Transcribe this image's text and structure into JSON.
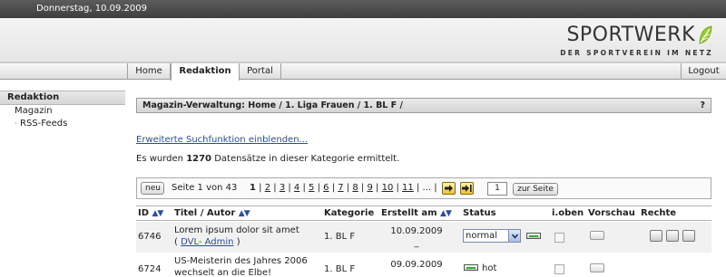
{
  "topbar": {
    "date": "Donnerstag, 10.09.2009"
  },
  "logo": {
    "word": "SPORTWERK",
    "sub": "DER SPORTVEREIN IM NETZ"
  },
  "nav": {
    "tabs": [
      "Home",
      "Redaktion",
      "Portal"
    ],
    "active": "Redaktion",
    "logout": "Logout"
  },
  "sidebar": {
    "header": "Redaktion",
    "items": [
      "Magazin"
    ],
    "subitems": [
      "RSS-Feeds"
    ]
  },
  "main": {
    "breadcrumb": "Magazin-Verwaltung: Home / 1. Liga Frauen / 1. BL F /",
    "help": "?",
    "advanced_link": "Erweiterte Suchfunktion einblenden...",
    "count_pre": "Es wurden",
    "count": "1270",
    "count_post": "Datensätze in dieser Kategorie ermittelt.",
    "pager": {
      "new_label": "neu",
      "page_info": "Seite 1 von 43",
      "current": "1",
      "pages": [
        "2",
        "3",
        "4",
        "5",
        "6",
        "7",
        "8",
        "9",
        "10",
        "11"
      ],
      "ellipsis": "...",
      "page_input": "1",
      "goto_label": "zur Seite"
    },
    "table": {
      "headers": {
        "id": "ID",
        "title": "Titel / Autor",
        "kategorie": "Kategorie",
        "erstellt": "Erstellt am",
        "status": "Status",
        "ioben": "i.oben",
        "vorschau": "Vorschau",
        "rechte": "Rechte"
      },
      "sort_glyph": "▲▼",
      "rows": [
        {
          "id": "6746",
          "title": "Lorem ipsum dolor sit amet",
          "author_open": "( ",
          "author": "DVL- Admin",
          "author_close": " )",
          "kategorie": "1. BL F",
          "date": "10.09.2009",
          "time": "_",
          "status": "normal"
        },
        {
          "id": "6724",
          "title": "US-Meisterin des Jahres 2006",
          "title2": "wechselt an die Elbe!",
          "kategorie": "1. BL F",
          "date": "09.09.2009",
          "time": "_",
          "status": "hot"
        }
      ]
    }
  },
  "colors": {
    "link": "#2a4f9a",
    "sort_arrow": "#2b4fa0",
    "status_green": "#2fae2f"
  }
}
